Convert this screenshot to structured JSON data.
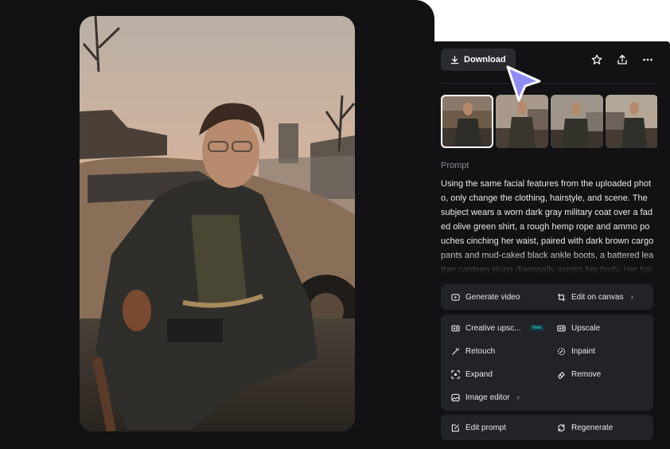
{
  "toolbar": {
    "download_label": "Download",
    "icons": [
      "download-icon",
      "star-icon",
      "share-icon",
      "more-icon"
    ]
  },
  "prompt": {
    "label": "Prompt",
    "text": "Using the same facial features from the uploaded photo, only change the clothing, hairstyle, and scene. The subject wears a worn dark gray military coat over a faded olive green shirt, a rough hemp rope and ammo pouches cinching her waist, paired with dark brown cargo pants and mud-caked black ankle boots, a battered leather canteen slung diagonally across her body. Her hair is cut into a"
  },
  "actions": {
    "generate_video": "Generate video",
    "edit_on_canvas": "Edit on canvas",
    "creative_upscale": "Creative upsc...",
    "new_badge": "New",
    "upscale": "Upscale",
    "retouch": "Retouch",
    "inpaint": "Inpaint",
    "expand": "Expand",
    "remove": "Remove",
    "image_editor": "Image editor",
    "edit_prompt": "Edit prompt",
    "regenerate": "Regenerate"
  },
  "colors": {
    "background": "#121214",
    "card": "#222327",
    "accent_cursor": "#8f8cf6",
    "badge": "#3fd6d2"
  }
}
